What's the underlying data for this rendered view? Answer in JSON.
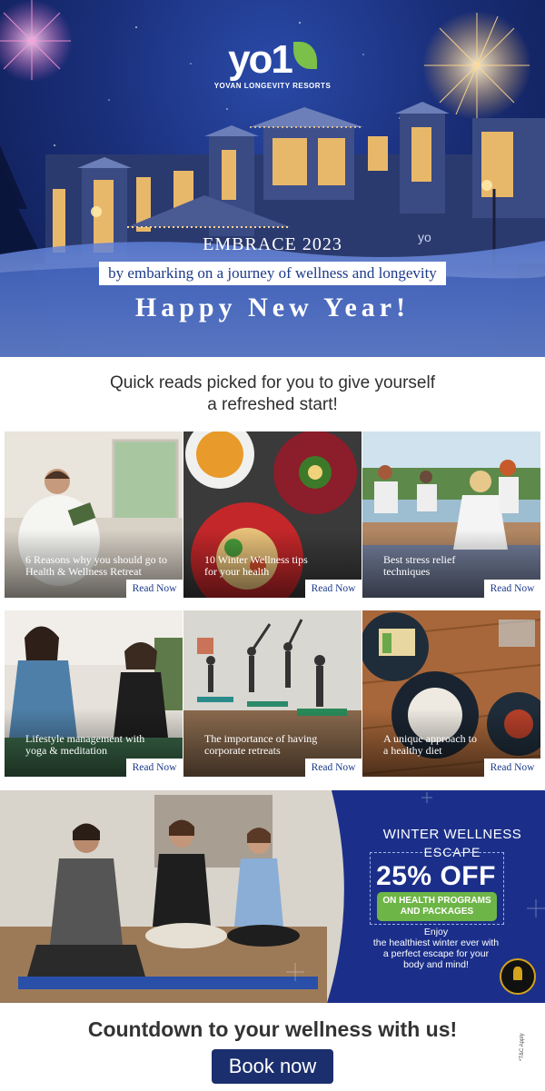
{
  "brand": {
    "logo_text": "yo1",
    "logo_subtitle": "YOVAN LONGEVITY RESORTS",
    "accent_color": "#7cc04a",
    "navy_color": "#1b2f8a"
  },
  "hero": {
    "headline": "EMBRACE 2023",
    "subline": "by embarking on a journey of wellness and longevity",
    "greeting": "Happy New Year!",
    "building_sign": "yo"
  },
  "intro": {
    "line1": "Quick reads picked for you to give yourself",
    "line2": "a refreshed start!"
  },
  "articles": [
    {
      "title_line1": "6 Reasons why you should go to",
      "title_line2": "Health & Wellness Retreat",
      "cta": "Read Now",
      "image": "man-reading-in-robe"
    },
    {
      "title_line1": "10 Winter Wellness tips",
      "title_line2": "for your health",
      "cta": "Read Now",
      "image": "healthy-food-plates"
    },
    {
      "title_line1": "Best stress relief",
      "title_line2": "techniques",
      "cta": "Read Now",
      "image": "group-meditation-lakeside"
    },
    {
      "title_line1": "Lifestyle management with",
      "title_line2": "yoga & meditation",
      "cta": "Read Now",
      "image": "women-meditating"
    },
    {
      "title_line1": "The importance of having",
      "title_line2": "corporate retreats",
      "cta": "Read Now",
      "image": "yoga-class-studio"
    },
    {
      "title_line1": "A unique approach to",
      "title_line2": "a healthy diet",
      "cta": "Read Now",
      "image": "gourmet-dishes-table"
    }
  ],
  "promo": {
    "title": "WINTER WELLNESS",
    "escape": "ESCAPE",
    "offer": "25% OFF",
    "badge_line1": "ON HEALTH PROGRAMS",
    "badge_line2": "AND PACKAGES",
    "body_line1": "Enjoy",
    "body_line2": "the healthiest winter ever with",
    "body_line3": "a perfect escape for your",
    "body_line4": "body and mind!",
    "award_icon": "award-seal-icon"
  },
  "footer": {
    "countdown": "Countdown to your wellness with us!",
    "cta": "Book now",
    "terms": "*T&C Apply"
  }
}
